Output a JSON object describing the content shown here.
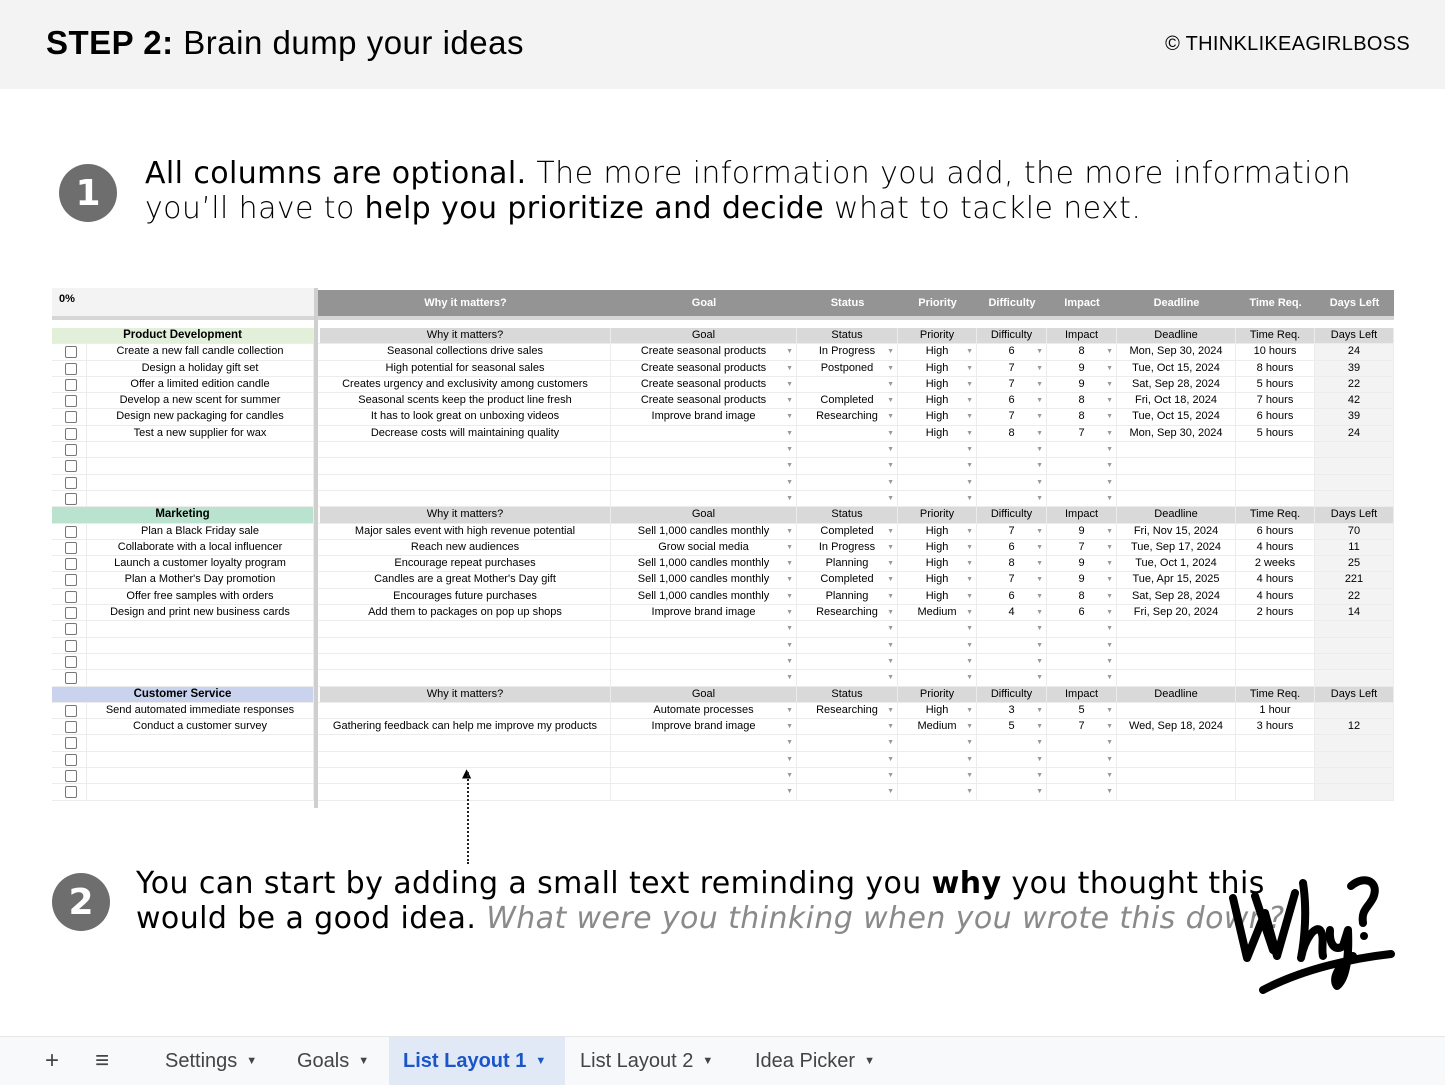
{
  "header": {
    "title_bold": "STEP 2:",
    "title_rest": " Brain dump your ideas",
    "copyright": "© THINKLIKEAGIRLBOSS"
  },
  "step1": {
    "number": "1",
    "bold1": "All columns are optional.",
    "text1": " The more information you add, the more information",
    "text2": "you’ll have to ",
    "bold2": "help you prioritize and decide",
    "text3": " what to tackle next."
  },
  "step2": {
    "number": "2",
    "text1": "You can start by adding a small text reminding you ",
    "bold1": "why",
    "text2": " you thought this",
    "text3": "would be a good idea. ",
    "italic": "What were you thinking when you wrote this down?",
    "why_graphic": "Why?"
  },
  "sheet": {
    "progress": "0%",
    "columns": [
      "Why it matters?",
      "Goal",
      "Status",
      "Priority",
      "Difficulty",
      "Impact",
      "Deadline",
      "Time Req.",
      "Days Left"
    ],
    "categories": [
      {
        "name": "Product Development",
        "color": "#e2efd9",
        "rows": [
          {
            "idea": "Create a new fall candle collection",
            "why": "Seasonal collections drive sales",
            "goal": "Create seasonal products",
            "status": "In Progress",
            "priority": "High",
            "difficulty": "6",
            "impact": "8",
            "deadline": "Mon, Sep 30, 2024",
            "time": "10 hours",
            "days": "24"
          },
          {
            "idea": "Design a holiday gift set",
            "why": "High potential for seasonal sales",
            "goal": "Create seasonal products",
            "status": "Postponed",
            "priority": "High",
            "difficulty": "7",
            "impact": "9",
            "deadline": "Tue, Oct 15, 2024",
            "time": "8 hours",
            "days": "39"
          },
          {
            "idea": "Offer a limited edition candle",
            "why": "Creates urgency and exclusivity among customers",
            "goal": "Create seasonal products",
            "status": "",
            "priority": "High",
            "difficulty": "7",
            "impact": "9",
            "deadline": "Sat, Sep 28, 2024",
            "time": "5 hours",
            "days": "22"
          },
          {
            "idea": "Develop a new scent for summer",
            "why": "Seasonal scents keep the product line fresh",
            "goal": "Create seasonal products",
            "status": "Completed",
            "priority": "High",
            "difficulty": "6",
            "impact": "8",
            "deadline": "Fri, Oct 18, 2024",
            "time": "7 hours",
            "days": "42"
          },
          {
            "idea": "Design new packaging for candles",
            "why": "It has to look great on unboxing videos",
            "goal": "Improve brand image",
            "status": "Researching",
            "priority": "High",
            "difficulty": "7",
            "impact": "8",
            "deadline": "Tue, Oct 15, 2024",
            "time": "6 hours",
            "days": "39"
          },
          {
            "idea": "Test a new supplier for wax",
            "why": "Decrease costs will maintaining quality",
            "goal": "",
            "status": "",
            "priority": "High",
            "difficulty": "8",
            "impact": "7",
            "deadline": "Mon, Sep 30, 2024",
            "time": "5 hours",
            "days": "24"
          },
          {},
          {},
          {},
          {}
        ]
      },
      {
        "name": "Marketing",
        "color": "#b9e3cf",
        "rows": [
          {
            "idea": "Plan a Black Friday sale",
            "why": "Major sales event with high revenue potential",
            "goal": "Sell 1,000 candles monthly",
            "status": "Completed",
            "priority": "High",
            "difficulty": "7",
            "impact": "9",
            "deadline": "Fri, Nov 15, 2024",
            "time": "6 hours",
            "days": "70"
          },
          {
            "idea": "Collaborate with a local influencer",
            "why": "Reach new audiences",
            "goal": "Grow social media",
            "status": "In Progress",
            "priority": "High",
            "difficulty": "6",
            "impact": "7",
            "deadline": "Tue, Sep 17, 2024",
            "time": "4 hours",
            "days": "11"
          },
          {
            "idea": "Launch a customer loyalty program",
            "why": "Encourage repeat purchases",
            "goal": "Sell 1,000 candles monthly",
            "status": "Planning",
            "priority": "High",
            "difficulty": "8",
            "impact": "9",
            "deadline": "Tue, Oct 1, 2024",
            "time": "2 weeks",
            "days": "25"
          },
          {
            "idea": "Plan a Mother's Day promotion",
            "why": "Candles are a great Mother's Day gift",
            "goal": "Sell 1,000 candles monthly",
            "status": "Completed",
            "priority": "High",
            "difficulty": "7",
            "impact": "9",
            "deadline": "Tue, Apr 15, 2025",
            "time": "4 hours",
            "days": "221"
          },
          {
            "idea": "Offer free samples with orders",
            "why": "Encourages future purchases",
            "goal": "Sell 1,000 candles monthly",
            "status": "Planning",
            "priority": "High",
            "difficulty": "6",
            "impact": "8",
            "deadline": "Sat, Sep 28, 2024",
            "time": "4 hours",
            "days": "22"
          },
          {
            "idea": "Design and print new business cards",
            "why": "Add them to packages on pop up shops",
            "goal": "Improve brand image",
            "status": "Researching",
            "priority": "Medium",
            "difficulty": "4",
            "impact": "6",
            "deadline": "Fri, Sep 20, 2024",
            "time": "2 hours",
            "days": "14"
          },
          {},
          {},
          {},
          {}
        ]
      },
      {
        "name": "Customer Service",
        "color": "#c9d3ee",
        "rows": [
          {
            "idea": "Send automated immediate responses",
            "why": "",
            "goal": "Automate processes",
            "status": "Researching",
            "priority": "High",
            "difficulty": "3",
            "impact": "5",
            "deadline": "",
            "time": "1 hour",
            "days": ""
          },
          {
            "idea": "Conduct a customer survey",
            "why": "Gathering feedback can help me improve my products",
            "goal": "Improve brand image",
            "status": "",
            "priority": "Medium",
            "difficulty": "5",
            "impact": "7",
            "deadline": "Wed, Sep 18, 2024",
            "time": "3 hours",
            "days": "12"
          },
          {},
          {},
          {},
          {}
        ]
      }
    ]
  },
  "tabs": {
    "add_icon": "+",
    "menu_icon": "≡",
    "items": [
      {
        "label": "Settings",
        "active": false
      },
      {
        "label": "Goals",
        "active": false
      },
      {
        "label": "List Layout 1",
        "active": true
      },
      {
        "label": "List Layout 2",
        "active": false
      },
      {
        "label": "Idea Picker",
        "active": false
      }
    ]
  }
}
